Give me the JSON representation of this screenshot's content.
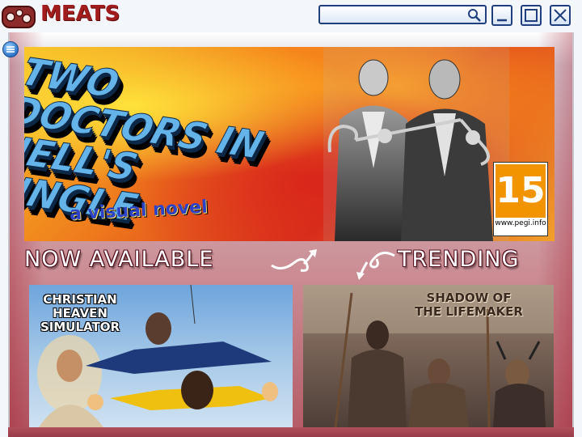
{
  "app": {
    "title": "MEATS",
    "accent": "#a11c1c",
    "logo_icon": "meat-logo-icon"
  },
  "search": {
    "value": "",
    "placeholder": "",
    "icon": "search-icon"
  },
  "window_controls": [
    {
      "name": "minimize",
      "icon": "minimize-icon"
    },
    {
      "name": "maximize",
      "icon": "maximize-icon"
    },
    {
      "name": "close",
      "icon": "close-icon"
    }
  ],
  "menu": {
    "icon": "hamburger-icon"
  },
  "hero": {
    "title": "Two Doctors in Hell's Jungle",
    "subtitle": "a visual novel",
    "rating": {
      "number": "15",
      "site": "www.pegi.info"
    }
  },
  "sections": {
    "now_available": "NOW AVAILABLE",
    "trending": "TRENDING"
  },
  "cards": [
    {
      "title": "CHRISTIAN\nHEAVEN\nSIMULATOR"
    },
    {
      "title": "SHADOW OF\nTHE LIFEMAKER"
    }
  ]
}
